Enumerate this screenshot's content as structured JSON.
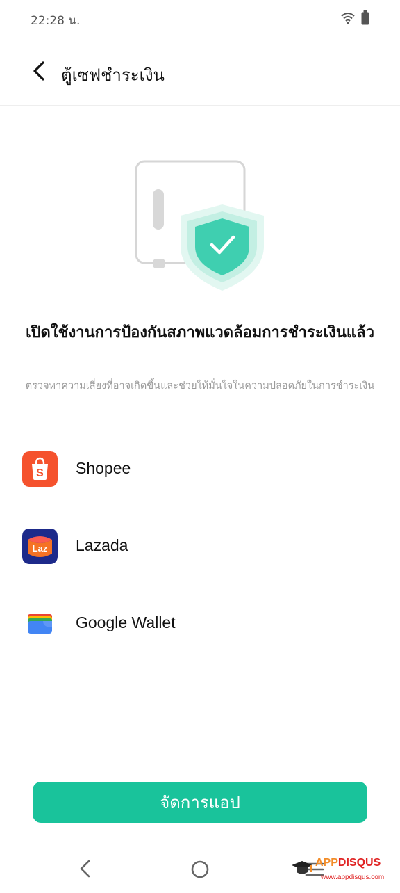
{
  "status_bar": {
    "time": "22:28 น."
  },
  "header": {
    "title": "ตู้เซฟชำระเงิน"
  },
  "main": {
    "heading": "เปิดใช้งานการป้องกันสภาพแวดล้อมการชำระเงินแล้ว",
    "subtext": "ตรวจหาความเสี่ยงที่อาจเกิดขึ้นและช่วยให้มั่นใจในความปลอดภัยในการชำระเงิน"
  },
  "apps": [
    {
      "name": "Shopee",
      "icon": "shopee-icon"
    },
    {
      "name": "Lazada",
      "icon": "lazada-icon",
      "icon_text": "Laz"
    },
    {
      "name": "Google Wallet",
      "icon": "google-wallet-icon"
    }
  ],
  "actions": {
    "manage_label": "จัดการแอป"
  },
  "watermark": {
    "logo_app": "APP",
    "logo_disqus": "DISQUS",
    "url": "www.appdisqus.com"
  },
  "colors": {
    "accent": "#19c39b",
    "shield": "#3fcfb0",
    "shopee": "#f5522d",
    "lazada_bg": "#1d2a8a"
  }
}
